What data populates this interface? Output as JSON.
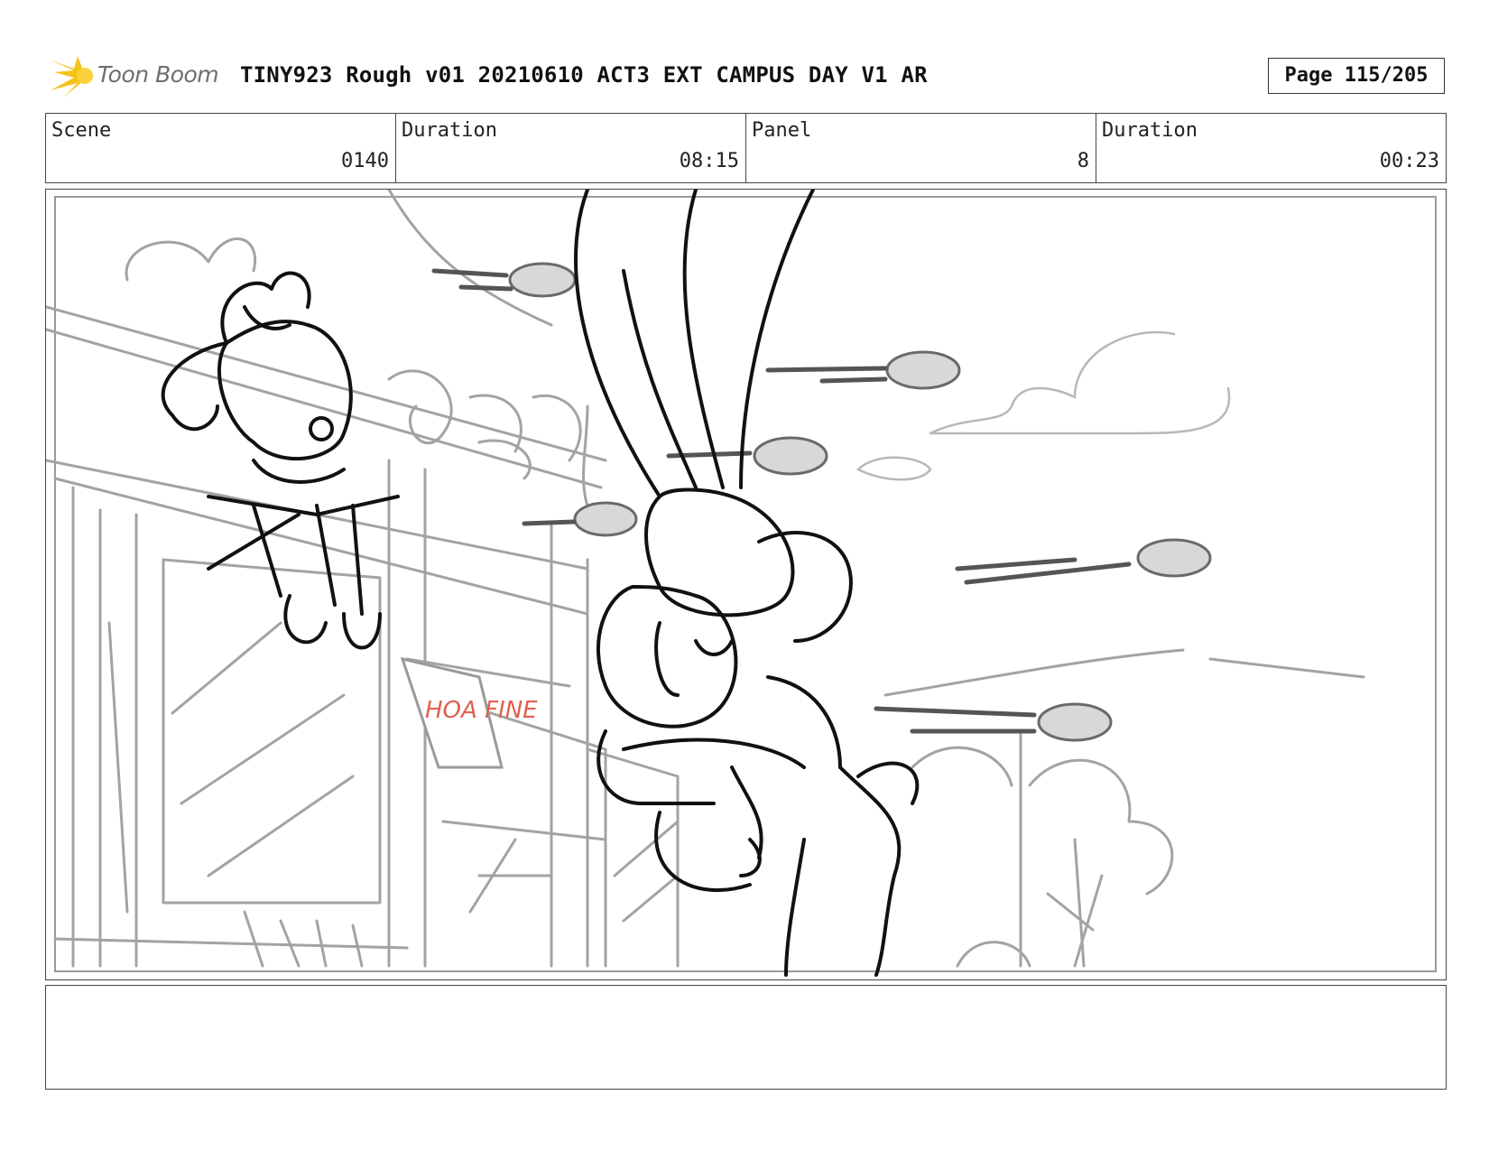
{
  "header": {
    "logo_text": "Toon Boom",
    "title": "TINY923 Rough v01 20210610 ACT3 EXT CAMPUS DAY V1 AR",
    "page": "Page 115/205"
  },
  "info": {
    "scene_label": "Scene",
    "scene_value": "0140",
    "scene_duration_label": "Duration",
    "scene_duration_value": "08:15",
    "panel_label": "Panel",
    "panel_value": "8",
    "panel_duration_label": "Duration",
    "panel_duration_value": "00:23"
  },
  "drawing": {
    "sign_text": "HOA FINE",
    "sign_color": "#e0614f",
    "sketch_color": "#111111",
    "background_color": "#9a9a9a"
  },
  "notes": {
    "text": ""
  }
}
